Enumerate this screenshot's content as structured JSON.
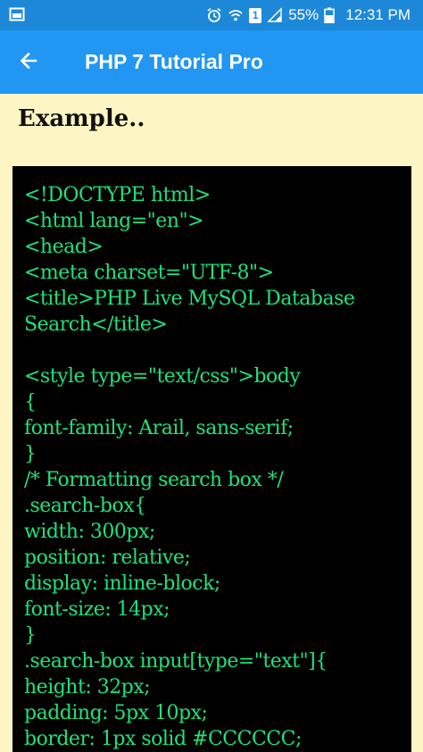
{
  "status_bar": {
    "battery": "55%",
    "time": "12:31 PM",
    "sim_label": "1",
    "icons": [
      "gallery-icon",
      "alarm-icon",
      "wifi-icon",
      "sim-icon",
      "signal-icon",
      "battery-icon"
    ]
  },
  "app_bar": {
    "title": "PHP 7 Tutorial Pro",
    "back_icon": "arrow-left-icon"
  },
  "section": {
    "title": "Example.."
  },
  "code": {
    "lines": [
      "<!DOCTYPE html>",
      "<html lang=\"en\">",
      "<head>",
      "<meta charset=\"UTF-8\">",
      "<title>PHP Live MySQL Database",
      "Search</title>",
      "",
      "<style type=\"text/css\">body",
      "{",
      "font-family: Arail, sans-serif;",
      "}",
      "/* Formatting search box */",
      ".search-box{",
      "width: 300px;",
      "position: relative;",
      "display: inline-block;",
      "font-size: 14px;",
      "}",
      ".search-box input[type=\"text\"]{",
      "height: 32px;",
      "padding: 5px 10px;",
      "border: 1px solid #CCCCCC;"
    ]
  },
  "colors": {
    "status_bar": "#1e88d8",
    "app_bar": "#2196f3",
    "page_background": "#fdf6c4",
    "code_background": "#000000",
    "code_text": "#1ee37a"
  }
}
